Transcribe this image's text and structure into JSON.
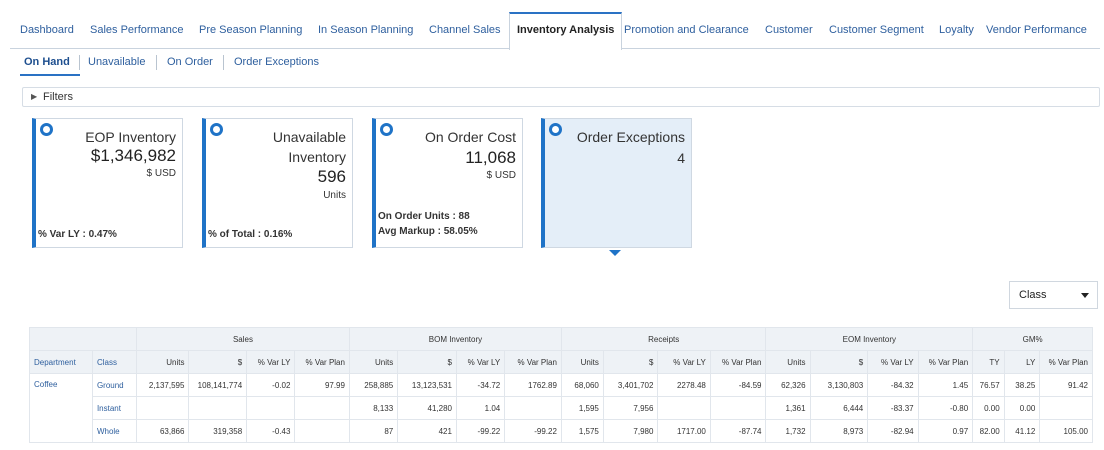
{
  "top_tabs": [
    {
      "label": "Dashboard"
    },
    {
      "label": "Sales Performance"
    },
    {
      "label": "Pre Season Planning"
    },
    {
      "label": "In Season Planning"
    },
    {
      "label": "Channel Sales"
    },
    {
      "label": "Inventory Analysis",
      "active": true
    },
    {
      "label": "Promotion and Clearance"
    },
    {
      "label": "Customer"
    },
    {
      "label": "Customer Segment"
    },
    {
      "label": "Loyalty"
    },
    {
      "label": "Vendor Performance"
    }
  ],
  "sub_tabs": [
    {
      "label": "On Hand",
      "active": true
    },
    {
      "label": "Unavailable"
    },
    {
      "label": "On Order"
    },
    {
      "label": "Order Exceptions"
    }
  ],
  "filters": {
    "label": "Filters",
    "icon": "triangle-right-icon"
  },
  "cards": {
    "eop": {
      "title": "EOP Inventory",
      "value": "$1,346,982",
      "unit": "$ USD",
      "footer": "% Var LY : 0.47%"
    },
    "unavailable": {
      "title_line1": "Unavailable",
      "title_line2": "Inventory",
      "value": "596",
      "unit": "Units",
      "footer": "% of Total : 0.16%"
    },
    "on_order": {
      "title": "On Order Cost",
      "value": "11,068",
      "unit": "$ USD",
      "footer_line1": "On Order Units : 88",
      "footer_line2": "Avg Markup : 58.05%"
    },
    "exceptions": {
      "title": "Order Exceptions",
      "value": "4",
      "selected": true
    }
  },
  "class_select": {
    "value": "Class"
  },
  "table": {
    "groups": [
      "Sales",
      "BOM Inventory",
      "Receipts",
      "EOM Inventory",
      "GM%"
    ],
    "headers": [
      "Department",
      "Class",
      "Units",
      "$",
      "% Var LY",
      "% Var Plan",
      "Units",
      "$",
      "% Var LY",
      "% Var Plan",
      "Units",
      "$",
      "% Var LY",
      "% Var Plan",
      "Units",
      "$",
      "% Var LY",
      "% Var Plan",
      "TY",
      "LY",
      "% Var Plan"
    ],
    "department": "Coffee",
    "rows": [
      {
        "class": "Ground",
        "cells": [
          "2,137,595",
          "108,141,774",
          "-0.02",
          "97.99",
          "258,885",
          "13,123,531",
          "-34.72",
          "1762.89",
          "68,060",
          "3,401,702",
          "2278.48",
          "-84.59",
          "62,326",
          "3,130,803",
          "-84.32",
          "1.45",
          "76.57",
          "38.25",
          "91.42"
        ]
      },
      {
        "class": "Instant",
        "cells": [
          "",
          "",
          "",
          "",
          "8,133",
          "41,280",
          "1.04",
          "",
          "1,595",
          "7,956",
          "",
          "",
          "1,361",
          "6,444",
          "-83.37",
          "-0.80",
          "0.00",
          "0.00",
          ""
        ]
      },
      {
        "class": "Whole",
        "cells": [
          "63,866",
          "319,358",
          "-0.43",
          "",
          "87",
          "421",
          "-99.22",
          "-99.22",
          "1,575",
          "7,980",
          "1717.00",
          "-87.74",
          "1,732",
          "8,973",
          "-82.94",
          "0.97",
          "82.00",
          "41.12",
          "105.00"
        ]
      }
    ]
  },
  "colors": {
    "accent": "#1f73c7",
    "link": "#2e5f9e",
    "header_bg": "#eef2f6",
    "selected_card_bg": "#e4eef8"
  }
}
